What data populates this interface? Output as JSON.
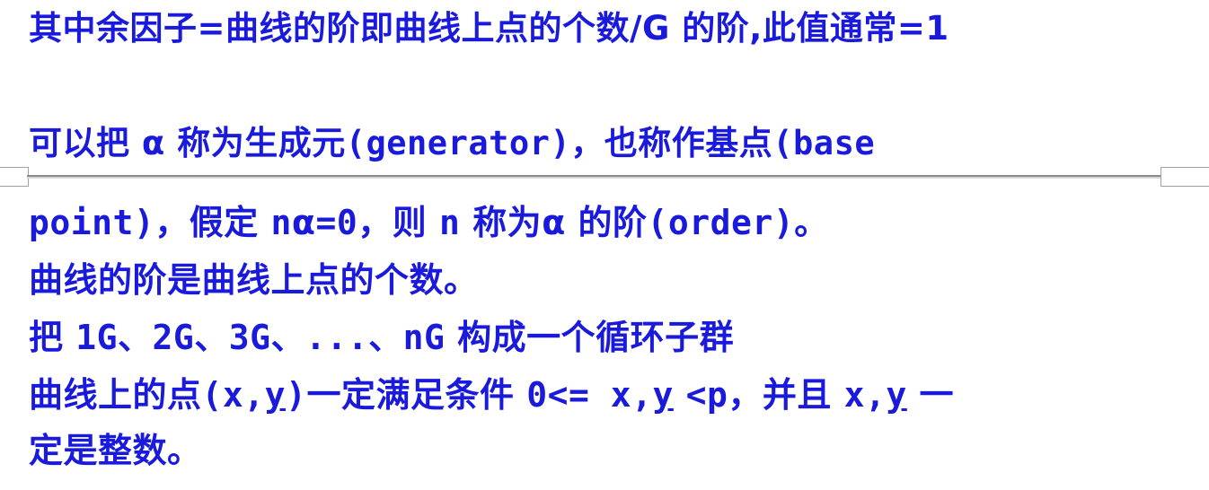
{
  "colors": {
    "text": "#1a1adc",
    "divider": "#8a8a8a"
  },
  "lines": {
    "l1": "其中余因子=曲线的阶即曲线上点的个数/G 的阶,此值通常=1",
    "l2": {
      "a": "可以把",
      "b": "α",
      "c": "称为生成元",
      "d": "(generator)",
      "e": "，也称作基点",
      "f": "(base"
    },
    "l3": {
      "a": "point)",
      "b": "，假定",
      "c": "n",
      "d": "α",
      "e": "=0",
      "f": "，则",
      "g": "n",
      "h": "称为",
      "i": "α",
      "j": "的阶",
      "k": "(order)",
      "l": "。"
    },
    "l4": "曲线的阶是曲线上点的个数。",
    "l5": {
      "a": "把",
      "b": "1G、2G、3G、...、nG",
      "c": "构成一个循环子群"
    },
    "l6": {
      "a": "曲线上的点",
      "b": "(x,",
      "c": "y",
      "d": ")",
      "e": "一定满足条件",
      "f": "0<= x,",
      "g": "y",
      "h": "<p",
      "i": "，并且",
      "j": "x,",
      "k": "y",
      "l": "一"
    },
    "l7": "定是整数。"
  }
}
